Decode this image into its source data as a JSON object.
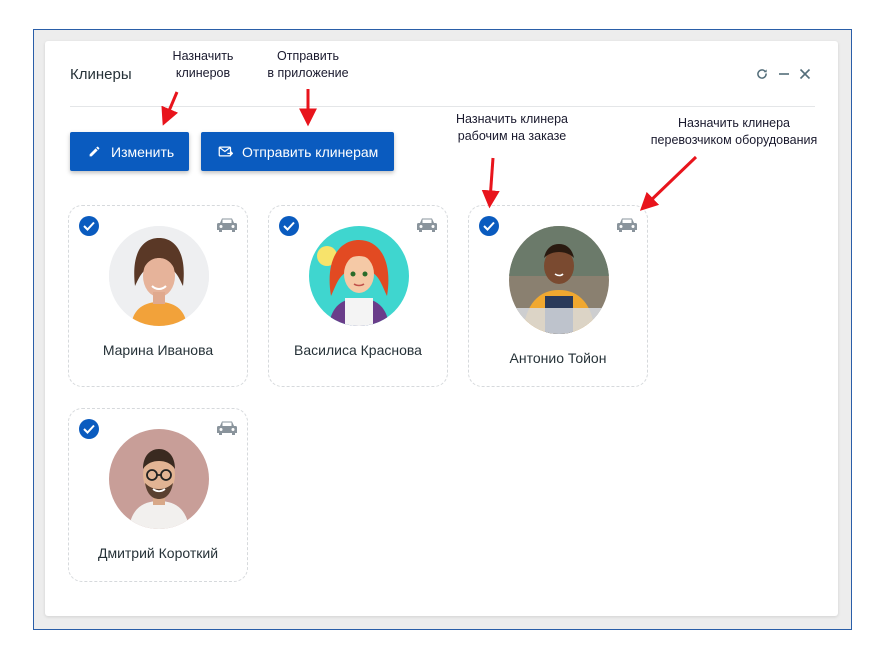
{
  "window": {
    "title": "Клинеры"
  },
  "toolbar": {
    "edit_label": "Изменить",
    "send_label": "Отправить клинерам"
  },
  "cleaners": [
    {
      "name": "Марина Иванова",
      "checked": true
    },
    {
      "name": "Василиса Краснова",
      "checked": true
    },
    {
      "name": "Антонио Тойон",
      "checked": true
    },
    {
      "name": "Дмитрий Короткий",
      "checked": true
    }
  ],
  "annotations": {
    "assign_line1": "Назначить",
    "assign_line2": "клинеров",
    "send_line1": "Отправить",
    "send_line2": "в приложение",
    "worker_line1": "Назначить клинера",
    "worker_line2": "рабочим на заказе",
    "carrier_line1": "Назначить клинера",
    "carrier_line2": "перевозчиком оборудования"
  },
  "colors": {
    "accent": "#0a5bbf",
    "arrow": "#e8141c",
    "frame": "#2a5ea8"
  }
}
